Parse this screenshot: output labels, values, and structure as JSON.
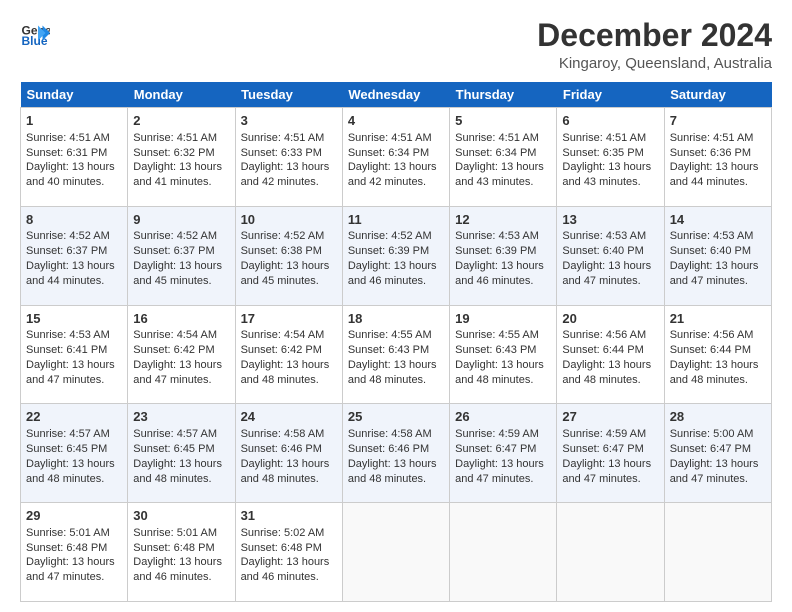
{
  "logo": {
    "line1": "General",
    "line2": "Blue",
    "arrow": "▶"
  },
  "header": {
    "title": "December 2024",
    "subtitle": "Kingaroy, Queensland, Australia"
  },
  "columns": [
    "Sunday",
    "Monday",
    "Tuesday",
    "Wednesday",
    "Thursday",
    "Friday",
    "Saturday"
  ],
  "weeks": [
    [
      {
        "day": "1",
        "lines": [
          "Sunrise: 4:51 AM",
          "Sunset: 6:31 PM",
          "Daylight: 13 hours",
          "and 40 minutes."
        ]
      },
      {
        "day": "2",
        "lines": [
          "Sunrise: 4:51 AM",
          "Sunset: 6:32 PM",
          "Daylight: 13 hours",
          "and 41 minutes."
        ]
      },
      {
        "day": "3",
        "lines": [
          "Sunrise: 4:51 AM",
          "Sunset: 6:33 PM",
          "Daylight: 13 hours",
          "and 42 minutes."
        ]
      },
      {
        "day": "4",
        "lines": [
          "Sunrise: 4:51 AM",
          "Sunset: 6:34 PM",
          "Daylight: 13 hours",
          "and 42 minutes."
        ]
      },
      {
        "day": "5",
        "lines": [
          "Sunrise: 4:51 AM",
          "Sunset: 6:34 PM",
          "Daylight: 13 hours",
          "and 43 minutes."
        ]
      },
      {
        "day": "6",
        "lines": [
          "Sunrise: 4:51 AM",
          "Sunset: 6:35 PM",
          "Daylight: 13 hours",
          "and 43 minutes."
        ]
      },
      {
        "day": "7",
        "lines": [
          "Sunrise: 4:51 AM",
          "Sunset: 6:36 PM",
          "Daylight: 13 hours",
          "and 44 minutes."
        ]
      }
    ],
    [
      {
        "day": "8",
        "lines": [
          "Sunrise: 4:52 AM",
          "Sunset: 6:37 PM",
          "Daylight: 13 hours",
          "and 44 minutes."
        ]
      },
      {
        "day": "9",
        "lines": [
          "Sunrise: 4:52 AM",
          "Sunset: 6:37 PM",
          "Daylight: 13 hours",
          "and 45 minutes."
        ]
      },
      {
        "day": "10",
        "lines": [
          "Sunrise: 4:52 AM",
          "Sunset: 6:38 PM",
          "Daylight: 13 hours",
          "and 45 minutes."
        ]
      },
      {
        "day": "11",
        "lines": [
          "Sunrise: 4:52 AM",
          "Sunset: 6:39 PM",
          "Daylight: 13 hours",
          "and 46 minutes."
        ]
      },
      {
        "day": "12",
        "lines": [
          "Sunrise: 4:53 AM",
          "Sunset: 6:39 PM",
          "Daylight: 13 hours",
          "and 46 minutes."
        ]
      },
      {
        "day": "13",
        "lines": [
          "Sunrise: 4:53 AM",
          "Sunset: 6:40 PM",
          "Daylight: 13 hours",
          "and 47 minutes."
        ]
      },
      {
        "day": "14",
        "lines": [
          "Sunrise: 4:53 AM",
          "Sunset: 6:40 PM",
          "Daylight: 13 hours",
          "and 47 minutes."
        ]
      }
    ],
    [
      {
        "day": "15",
        "lines": [
          "Sunrise: 4:53 AM",
          "Sunset: 6:41 PM",
          "Daylight: 13 hours",
          "and 47 minutes."
        ]
      },
      {
        "day": "16",
        "lines": [
          "Sunrise: 4:54 AM",
          "Sunset: 6:42 PM",
          "Daylight: 13 hours",
          "and 47 minutes."
        ]
      },
      {
        "day": "17",
        "lines": [
          "Sunrise: 4:54 AM",
          "Sunset: 6:42 PM",
          "Daylight: 13 hours",
          "and 48 minutes."
        ]
      },
      {
        "day": "18",
        "lines": [
          "Sunrise: 4:55 AM",
          "Sunset: 6:43 PM",
          "Daylight: 13 hours",
          "and 48 minutes."
        ]
      },
      {
        "day": "19",
        "lines": [
          "Sunrise: 4:55 AM",
          "Sunset: 6:43 PM",
          "Daylight: 13 hours",
          "and 48 minutes."
        ]
      },
      {
        "day": "20",
        "lines": [
          "Sunrise: 4:56 AM",
          "Sunset: 6:44 PM",
          "Daylight: 13 hours",
          "and 48 minutes."
        ]
      },
      {
        "day": "21",
        "lines": [
          "Sunrise: 4:56 AM",
          "Sunset: 6:44 PM",
          "Daylight: 13 hours",
          "and 48 minutes."
        ]
      }
    ],
    [
      {
        "day": "22",
        "lines": [
          "Sunrise: 4:57 AM",
          "Sunset: 6:45 PM",
          "Daylight: 13 hours",
          "and 48 minutes."
        ]
      },
      {
        "day": "23",
        "lines": [
          "Sunrise: 4:57 AM",
          "Sunset: 6:45 PM",
          "Daylight: 13 hours",
          "and 48 minutes."
        ]
      },
      {
        "day": "24",
        "lines": [
          "Sunrise: 4:58 AM",
          "Sunset: 6:46 PM",
          "Daylight: 13 hours",
          "and 48 minutes."
        ]
      },
      {
        "day": "25",
        "lines": [
          "Sunrise: 4:58 AM",
          "Sunset: 6:46 PM",
          "Daylight: 13 hours",
          "and 48 minutes."
        ]
      },
      {
        "day": "26",
        "lines": [
          "Sunrise: 4:59 AM",
          "Sunset: 6:47 PM",
          "Daylight: 13 hours",
          "and 47 minutes."
        ]
      },
      {
        "day": "27",
        "lines": [
          "Sunrise: 4:59 AM",
          "Sunset: 6:47 PM",
          "Daylight: 13 hours",
          "and 47 minutes."
        ]
      },
      {
        "day": "28",
        "lines": [
          "Sunrise: 5:00 AM",
          "Sunset: 6:47 PM",
          "Daylight: 13 hours",
          "and 47 minutes."
        ]
      }
    ],
    [
      {
        "day": "29",
        "lines": [
          "Sunrise: 5:01 AM",
          "Sunset: 6:48 PM",
          "Daylight: 13 hours",
          "and 47 minutes."
        ]
      },
      {
        "day": "30",
        "lines": [
          "Sunrise: 5:01 AM",
          "Sunset: 6:48 PM",
          "Daylight: 13 hours",
          "and 46 minutes."
        ]
      },
      {
        "day": "31",
        "lines": [
          "Sunrise: 5:02 AM",
          "Sunset: 6:48 PM",
          "Daylight: 13 hours",
          "and 46 minutes."
        ]
      },
      null,
      null,
      null,
      null
    ]
  ]
}
